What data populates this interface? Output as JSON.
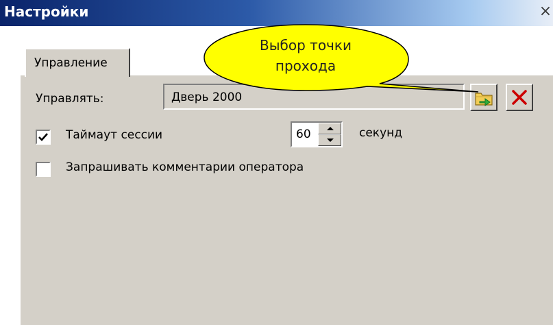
{
  "window": {
    "title": "Настройки",
    "close_glyph": "×"
  },
  "tabs": [
    {
      "label": "Управление",
      "active": true
    }
  ],
  "control": {
    "label": "Управлять:",
    "value": "Дверь 2000",
    "select_button_icon": "folder-arrow-icon",
    "clear_button_icon": "red-x-icon"
  },
  "timeout": {
    "checkbox_label": "Таймаут сессии",
    "checked": true,
    "value": "60",
    "unit": "секунд"
  },
  "ask_comments": {
    "checkbox_label": "Запрашивать комментарии оператора",
    "checked": false
  },
  "callout": {
    "line1": "Выбор точки",
    "line2": "прохода",
    "fill": "#ffff00"
  },
  "colors": {
    "panel": "#d4d0c8",
    "titlebar_start": "#0a246a",
    "accent_red": "#cc0000"
  }
}
